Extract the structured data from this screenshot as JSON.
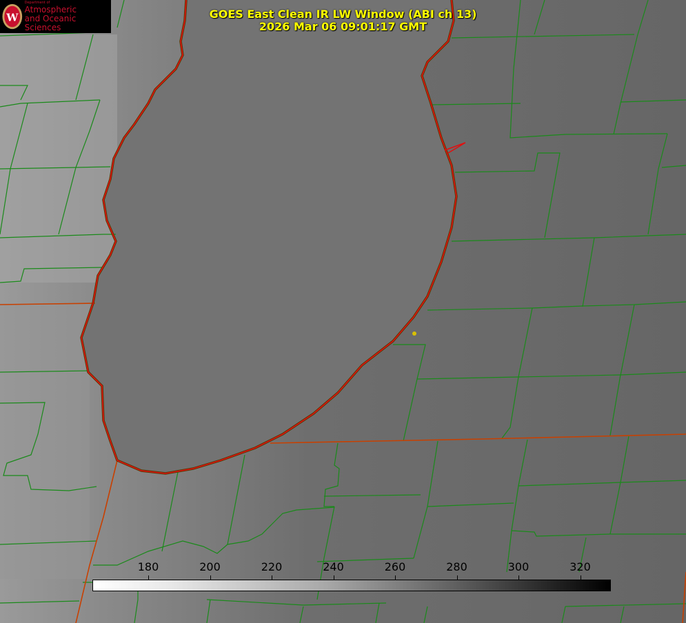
{
  "header": {
    "title_line1": "GOES East Clean IR LW Window (ABI ch 13)",
    "title_line2": "2026 Mar 06 09:01:17 GMT"
  },
  "logo": {
    "dept": "Department of",
    "line1": "Atmospheric",
    "line2": "and Oceanic Sciences",
    "seal_letter": "W"
  },
  "colorbar": {
    "ticks": [
      "180",
      "200",
      "220",
      "240",
      "260",
      "280",
      "300",
      "320"
    ],
    "range_min_label": "",
    "gradient": [
      "#ffffff",
      "#000000"
    ]
  },
  "colors": {
    "county_lines": "#1a8a1a",
    "state_lines": "#c83c00",
    "coastline": "#e01010",
    "marker": "#d8c000",
    "title": "#ffff00"
  }
}
